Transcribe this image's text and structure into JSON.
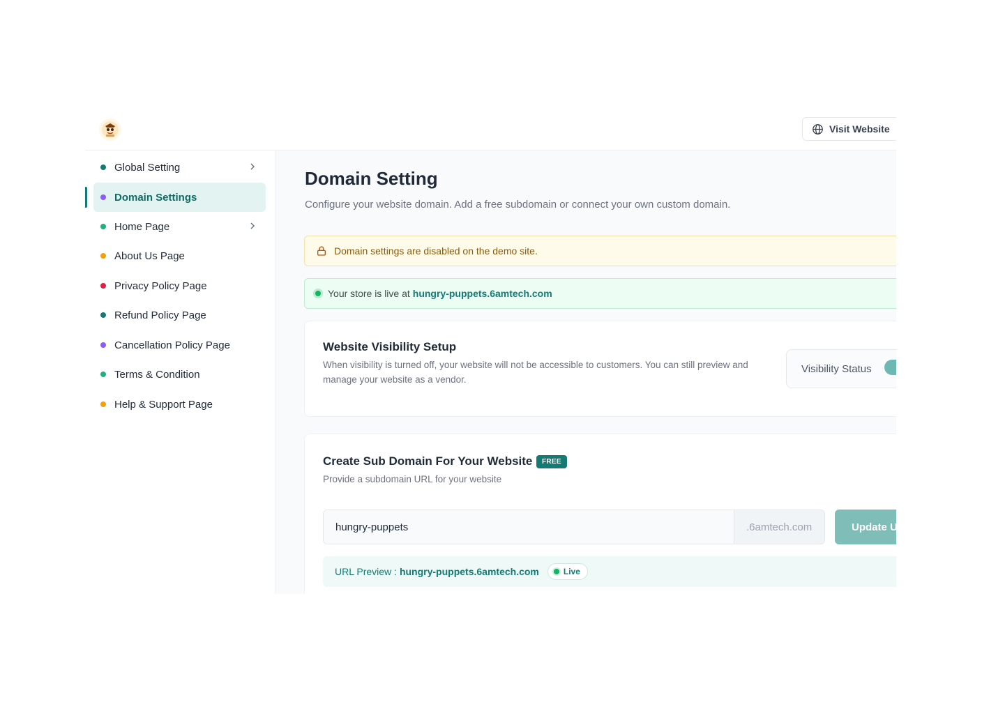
{
  "header": {
    "logo_icon": "puppet-logo-icon",
    "visit_website_label": "Visit Website",
    "visit_website_icon": "globe-icon"
  },
  "sidebar": {
    "items": [
      {
        "label": "Global Setting",
        "dot_color": "#137b74",
        "has_chevron": true,
        "active": false
      },
      {
        "label": "Domain Settings",
        "dot_color": "#8b5cf6",
        "has_chevron": false,
        "active": true
      },
      {
        "label": "Home Page",
        "dot_color": "#22b07d",
        "has_chevron": true,
        "active": false
      },
      {
        "label": "About Us Page",
        "dot_color": "#f59e0b",
        "has_chevron": false,
        "active": false
      },
      {
        "label": "Privacy Policy Page",
        "dot_color": "#e11d48",
        "has_chevron": false,
        "active": false
      },
      {
        "label": "Refund Policy Page",
        "dot_color": "#137b74",
        "has_chevron": false,
        "active": false
      },
      {
        "label": "Cancellation Policy Page",
        "dot_color": "#8b5cf6",
        "has_chevron": false,
        "active": false
      },
      {
        "label": "Terms & Condition",
        "dot_color": "#22b07d",
        "has_chevron": false,
        "active": false
      },
      {
        "label": "Help & Support Page",
        "dot_color": "#f59e0b",
        "has_chevron": false,
        "active": false
      }
    ]
  },
  "main": {
    "title": "Domain Setting",
    "subtitle": "Configure your website domain. Add a free subdomain or connect your own custom domain.",
    "warning": {
      "icon": "lock-icon",
      "text": "Domain settings are disabled on the demo site."
    },
    "live_banner": {
      "prefix": "Your store is live at",
      "url": "hungry-puppets.6amtech.com"
    },
    "visibility": {
      "title": "Website Visibility Setup",
      "desc_line1": "When visibility is turned off, your website will not be accessible to customers. You can still preview and",
      "desc_line2": "manage your website as a vendor.",
      "status_label": "Visibility Status",
      "status_on": true
    },
    "subdomain": {
      "title": "Create Sub Domain For Your Website",
      "badge": "FREE",
      "desc": "Provide a subdomain URL for your website",
      "input_value": "hungry-puppets",
      "suffix": ".6amtech.com",
      "update_label": "Update URL",
      "preview_prefix": "URL Preview :",
      "preview_url": "hungry-puppets.6amtech.com",
      "live_label": "Live"
    }
  },
  "colors": {
    "accent": "#137b74",
    "active_bg": "#e3f3f1",
    "warning_bg": "#fffbeb",
    "success_bg": "#ecfdf3"
  }
}
